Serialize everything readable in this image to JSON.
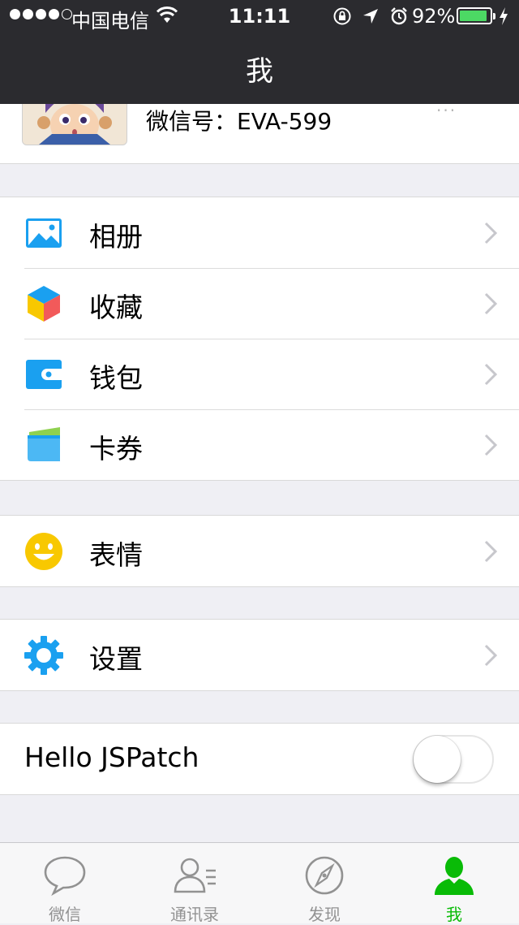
{
  "status_bar": {
    "carrier": "中国电信",
    "time": "11:11",
    "battery_percent": "92%",
    "battery_level": 0.92,
    "signal_bars": 4,
    "signal_total": 5
  },
  "nav": {
    "title": "我"
  },
  "profile": {
    "wechat_id": "微信号：EVA-599",
    "more": "···"
  },
  "groups": [
    [
      {
        "label": "相册",
        "icon": "photo-album-icon"
      },
      {
        "label": "收藏",
        "icon": "favorites-cube-icon"
      },
      {
        "label": "钱包",
        "icon": "wallet-icon"
      },
      {
        "label": "卡券",
        "icon": "card-coupon-icon"
      }
    ],
    [
      {
        "label": "表情",
        "icon": "smiley-icon"
      }
    ],
    [
      {
        "label": "设置",
        "icon": "gear-icon"
      }
    ],
    [
      {
        "label": "Hello JSPatch",
        "toggle": false
      }
    ]
  ],
  "tabbar": {
    "tabs": [
      {
        "label": "微信",
        "icon": "chat-bubble-icon",
        "active": false
      },
      {
        "label": "通讯录",
        "icon": "contacts-icon",
        "active": false
      },
      {
        "label": "发现",
        "icon": "compass-icon",
        "active": false
      },
      {
        "label": "我",
        "icon": "person-icon",
        "active": true
      }
    ]
  },
  "colors": {
    "nav_bg": "#2b2b2f",
    "accent_green": "#09bb07",
    "battery_green": "#4cd964",
    "icon_blue": "#1aa0f0",
    "smiley_yellow": "#f8c800"
  }
}
